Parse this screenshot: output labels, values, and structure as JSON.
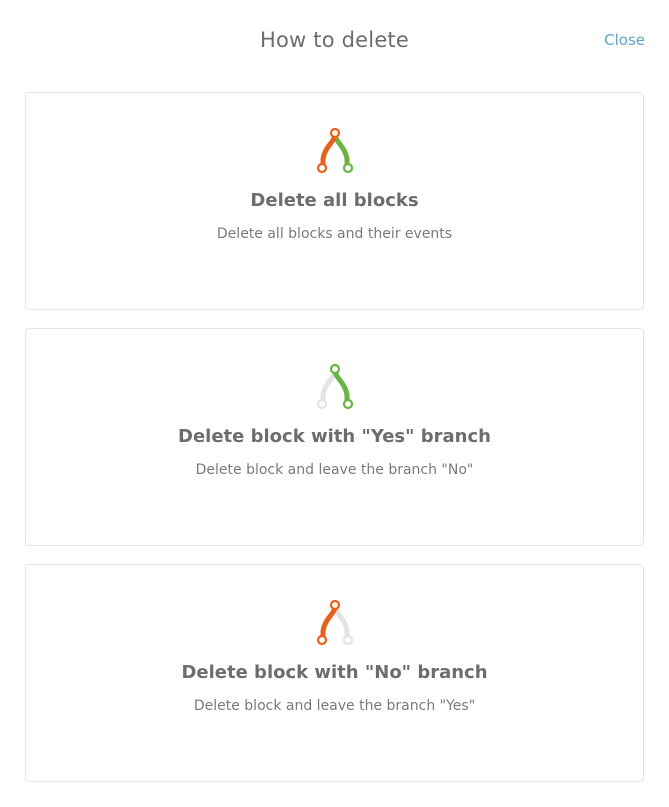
{
  "header": {
    "title": "How to delete",
    "close_label": "Close"
  },
  "options": [
    {
      "title": "Delete all blocks",
      "description": "Delete all blocks and their events",
      "icon": "branch-both-icon"
    },
    {
      "title": "Delete block with \"Yes\" branch",
      "description": "Delete block and leave the branch \"No\"",
      "icon": "branch-yes-icon"
    },
    {
      "title": "Delete block with \"No\" branch",
      "description": "Delete block and leave the branch \"Yes\"",
      "icon": "branch-no-icon"
    }
  ],
  "colors": {
    "orange": "#e8601c",
    "green": "#6ab443",
    "gray": "#e3e3e3",
    "close": "#5fa3c9"
  }
}
